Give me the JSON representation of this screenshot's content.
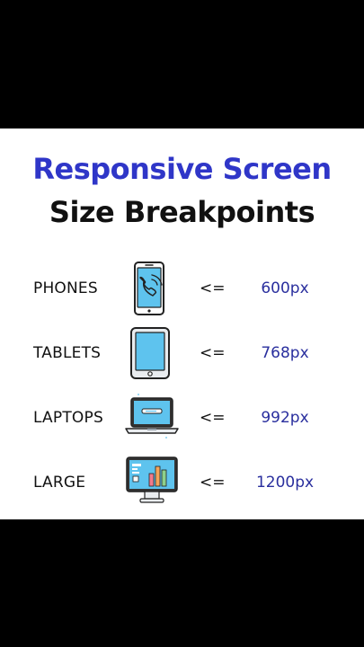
{
  "heading": {
    "line1": "Responsive Screen",
    "line2": "Size Breakpoints"
  },
  "breakpoints": [
    {
      "device": "PHONES",
      "icon": "smartphone-icon",
      "operator": "<=",
      "value": "600px"
    },
    {
      "device": "TABLETS",
      "icon": "tablet-icon",
      "operator": "<=",
      "value": "768px"
    },
    {
      "device": "LAPTOPS",
      "icon": "laptop-icon",
      "operator": "<=",
      "value": "992px"
    },
    {
      "device": "LARGE",
      "icon": "desktop-monitor-icon",
      "operator": "<=",
      "value": "1200px"
    }
  ],
  "colors": {
    "title_accent": "#2f36c8",
    "value_text": "#2a2f9e",
    "device_screen": "#5ec3ee",
    "background_bars": "#000000"
  }
}
